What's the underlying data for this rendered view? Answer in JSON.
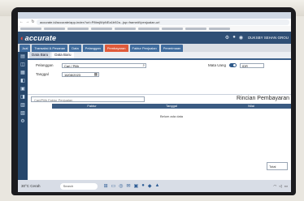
{
  "browser": {
    "url": "accurate.id/accurate/app-index?url=P8tmjWpNEa1b92a...jsp=frame#!/penjualan-url",
    "nav_back": "←",
    "nav_forward": "→",
    "nav_reload": "↻"
  },
  "app": {
    "logo_text": "accurate",
    "logo_mark": "◐",
    "database_name": "DUKSBY SEHAN GROU",
    "module_tabs": [
      {
        "label": "Jual"
      },
      {
        "label": "Transaksi & Pesanan"
      },
      {
        "label": "Data"
      },
      {
        "label": "Pelanggan"
      },
      {
        "label": "Pembayaran",
        "active": true
      },
      {
        "label": "Faktur Penjualan"
      },
      {
        "label": "Penerimaan"
      }
    ],
    "sub_tabs": [
      {
        "label": "Data Baru"
      },
      {
        "label": "Data Baru"
      }
    ]
  },
  "form": {
    "customer_label": "Pelanggan",
    "customer_value": "Cari / Pilih",
    "date_label": "Tanggal",
    "date_value": "16/08/2023",
    "currency_label": "Mata Uang",
    "currency_value": "IDR"
  },
  "detail": {
    "search_placeholder": "Cari/Pilih Faktur Penjualan",
    "section_title": "Rincian Pembayaran",
    "table_headers": [
      "Faktur",
      "Tanggal",
      "Nilai"
    ],
    "empty_text": "Belum ada data",
    "total_label": "Total"
  },
  "taskbar": {
    "weather": "30°C Cerah",
    "search_placeholder": "Search"
  }
}
